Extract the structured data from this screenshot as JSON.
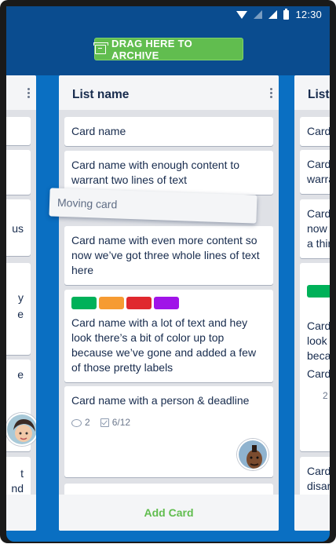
{
  "status_bar": {
    "time": "12:30",
    "icons": [
      "wifi-icon",
      "signal-icon",
      "signal-icon",
      "battery-icon"
    ]
  },
  "archive": {
    "label": "DRAG HERE TO ARCHIVE",
    "icon": "archive-icon",
    "color": "#61bd4f"
  },
  "colors": {
    "board_bg": "#0a6fc2",
    "header_bg": "#0a4c8f",
    "list_bg": "#dfe1e6",
    "add_card": "#61bd4f"
  },
  "left_list": {
    "cards": [
      "",
      "",
      "us",
      "y\ne",
      "e",
      "t\nnd"
    ]
  },
  "main_list": {
    "title": "List name",
    "cards": [
      {
        "text": "Card name"
      },
      {
        "text": "Card name with enough content to warrant two lines of text"
      },
      {
        "text": "Card name with even more content so now we’ve got three whole lines of text here"
      },
      {
        "text": "Card name with a lot of text and hey look there’s a bit of color up top because we’ve gone and added a few of those pretty labels",
        "labels": [
          "#00b159",
          "#f69b32",
          "#e0282e",
          "#a014e8"
        ]
      },
      {
        "text": "Card name with a person & deadline",
        "comments": "2",
        "checklist": "6/12"
      }
    ],
    "add_card": "Add Card"
  },
  "moving_card": {
    "text": "Moving card"
  },
  "right_list": {
    "title": "List",
    "cards": [
      "Card",
      "Card\nwarra",
      "Card\nnow w\na thir",
      "Card\nlook\nbecau\nof tho",
      "Card",
      "Card\ndisar"
    ],
    "badge": "2"
  }
}
